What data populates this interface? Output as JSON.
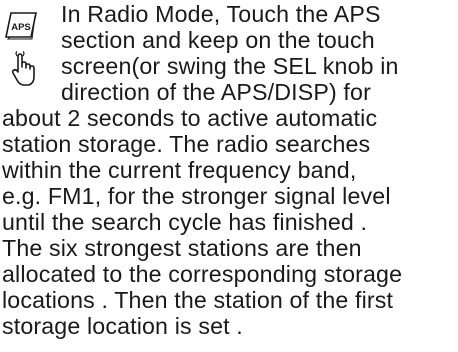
{
  "instruction": {
    "icon_key_label": "APS",
    "lines": [
      "In Radio Mode, Touch the APS",
      "section and keep on the touch",
      "screen(or swing the SEL knob in",
      "direction of the APS/DISP) for",
      "about 2 seconds to active automatic",
      "station storage. The radio searches",
      "within the current frequency band,",
      "e.g. FM1, for the stronger signal level",
      "until the search cycle has finished .",
      "The six strongest stations are then",
      "allocated to the corresponding storage",
      "locations . Then the station of the first",
      "storage location is set ."
    ]
  }
}
